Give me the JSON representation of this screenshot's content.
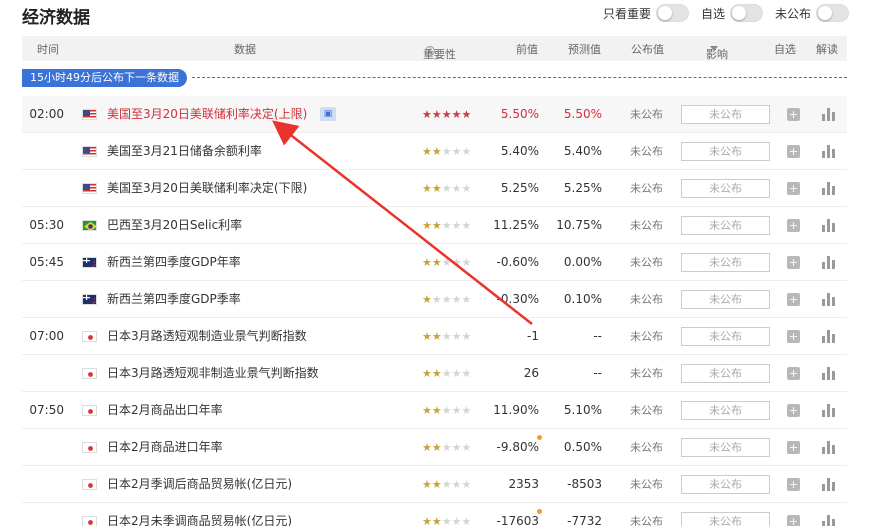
{
  "page": {
    "title": "经济数据"
  },
  "filters": [
    {
      "label": "只看重要"
    },
    {
      "label": "自选"
    },
    {
      "label": "未公布"
    }
  ],
  "table_header": {
    "time": "时间",
    "data": "数据",
    "importance": "重要性",
    "previous": "前值",
    "forecast": "预测值",
    "actual": "公布值",
    "impact": "影响",
    "watchlist": "自选",
    "analysis": "解读"
  },
  "notice": "15小时49分后公布下一条数据",
  "rows": [
    {
      "time": "02:00",
      "flag": "us",
      "name": "美国至3月20日美联储利率决定(上限)",
      "stars": 5,
      "previous": "5.50%",
      "forecast": "5.50%",
      "actual": "未公布",
      "impact": "未公布",
      "highlight": true
    },
    {
      "time": "",
      "flag": "us",
      "name": "美国至3月21日储备余额利率",
      "stars": 2,
      "previous": "5.40%",
      "forecast": "5.40%",
      "actual": "未公布",
      "impact": "未公布"
    },
    {
      "time": "",
      "flag": "us",
      "name": "美国至3月20日美联储利率决定(下限)",
      "stars": 2,
      "previous": "5.25%",
      "forecast": "5.25%",
      "actual": "未公布",
      "impact": "未公布"
    },
    {
      "time": "05:30",
      "flag": "br",
      "name": "巴西至3月20日Selic利率",
      "stars": 2,
      "previous": "11.25%",
      "forecast": "10.75%",
      "actual": "未公布",
      "impact": "未公布"
    },
    {
      "time": "05:45",
      "flag": "nz",
      "name": "新西兰第四季度GDP年率",
      "stars": 2,
      "previous": "-0.60%",
      "forecast": "0.00%",
      "actual": "未公布",
      "impact": "未公布"
    },
    {
      "time": "",
      "flag": "nz",
      "name": "新西兰第四季度GDP季率",
      "stars": 1,
      "previous": "-0.30%",
      "forecast": "0.10%",
      "actual": "未公布",
      "impact": "未公布"
    },
    {
      "time": "07:00",
      "flag": "jp",
      "name": "日本3月路透短观制造业景气判断指数",
      "stars": 2,
      "previous": "-1",
      "forecast": "--",
      "actual": "未公布",
      "impact": "未公布"
    },
    {
      "time": "",
      "flag": "jp",
      "name": "日本3月路透短观非制造业景气判断指数",
      "stars": 2,
      "previous": "26",
      "forecast": "--",
      "actual": "未公布",
      "impact": "未公布"
    },
    {
      "time": "07:50",
      "flag": "jp",
      "name": "日本2月商品出口年率",
      "stars": 2,
      "previous": "11.90%",
      "forecast": "5.10%",
      "actual": "未公布",
      "impact": "未公布"
    },
    {
      "time": "",
      "flag": "jp",
      "name": "日本2月商品进口年率",
      "stars": 2,
      "previous": "-9.80%",
      "forecast": "0.50%",
      "actual": "未公布",
      "impact": "未公布",
      "revised": true
    },
    {
      "time": "",
      "flag": "jp",
      "name": "日本2月季调后商品贸易帐(亿日元)",
      "stars": 2,
      "previous": "2353",
      "forecast": "-8503",
      "actual": "未公布",
      "impact": "未公布"
    },
    {
      "time": "",
      "flag": "jp",
      "name": "日本2月未季调商品贸易帐(亿日元)",
      "stars": 2,
      "previous": "-17603",
      "forecast": "-7732",
      "actual": "未公布",
      "impact": "未公布",
      "revised": true
    }
  ],
  "colors": {
    "accent": "#3a72d8",
    "highlight_red": "#d0303a",
    "annotation_arrow": "#e8342c"
  }
}
